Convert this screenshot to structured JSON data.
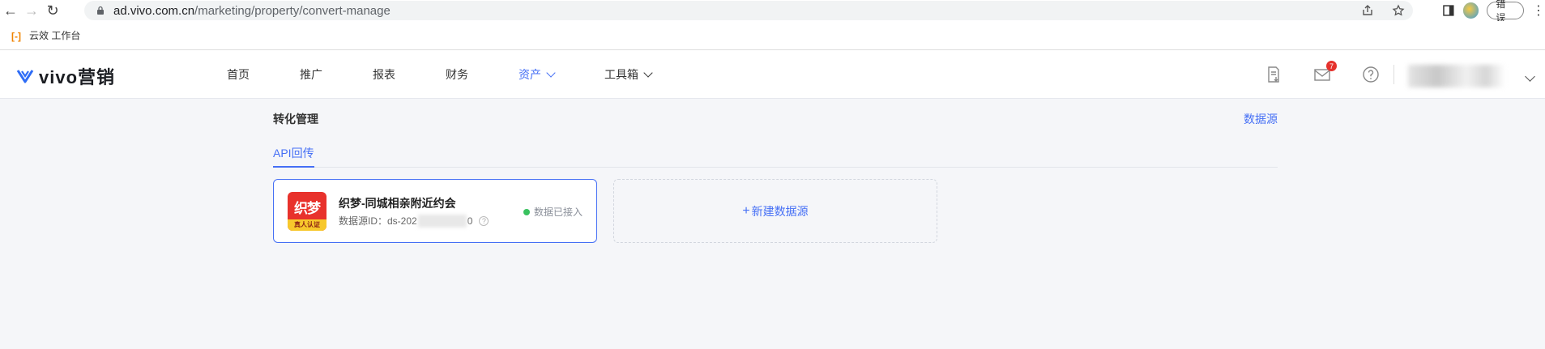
{
  "browser": {
    "url_host": "ad.vivo.com.cn",
    "url_path": "/marketing/property/convert-manage",
    "error_label": "错误"
  },
  "bookmarks": {
    "item1": "云效 工作台"
  },
  "header": {
    "logo_text": "vivo营销",
    "nav": [
      "首页",
      "推广",
      "报表",
      "财务",
      "资产",
      "工具箱"
    ],
    "active_nav": "资产",
    "message_count": "7",
    "accent_color": "#456ff5"
  },
  "page": {
    "title": "转化管理",
    "data_source_link": "数据源",
    "tab_api": "API回传"
  },
  "source_card": {
    "logo_text": "织梦",
    "logo_band": "真人认证",
    "name": "织梦-同城相亲附近约会",
    "id_label": "数据源ID：ds-202",
    "id_tail": "0",
    "status": "数据已接入",
    "status_color": "#39c25f"
  },
  "add_card": {
    "label": "新建数据源"
  }
}
